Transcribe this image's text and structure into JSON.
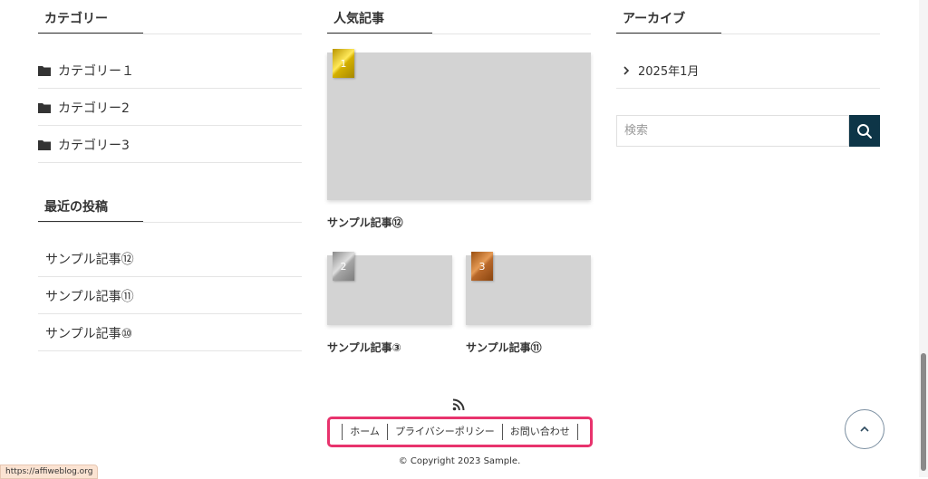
{
  "categories_widget": {
    "title": "カテゴリー",
    "items": [
      "カテゴリー１",
      "カテゴリー2",
      "カテゴリー3"
    ]
  },
  "recent_widget": {
    "title": "最近の投稿",
    "items": [
      "サンプル記事⑫",
      "サンプル記事⑪",
      "サンプル記事⑩"
    ]
  },
  "popular_widget": {
    "title": "人気記事",
    "posts": [
      {
        "rank": "1",
        "title": "サンプル記事⑫"
      },
      {
        "rank": "2",
        "title": "サンプル記事③"
      },
      {
        "rank": "3",
        "title": "サンプル記事⑪"
      }
    ]
  },
  "archive_widget": {
    "title": "アーカイブ",
    "items": [
      "2025年1月"
    ]
  },
  "search": {
    "placeholder": "検索",
    "icon": "search-icon"
  },
  "footer": {
    "nav": [
      "ホーム",
      "プライバシーポリシー",
      "お問い合わせ"
    ],
    "copyright": "© Copyright 2023 Sample.",
    "rss_icon": "rss-icon",
    "highlight_color": "#e8336d"
  },
  "status_bar": {
    "url": "https://affiweblog.org"
  },
  "colors": {
    "accent": "#0d3547",
    "thumbnail": "#d3d3d3"
  }
}
